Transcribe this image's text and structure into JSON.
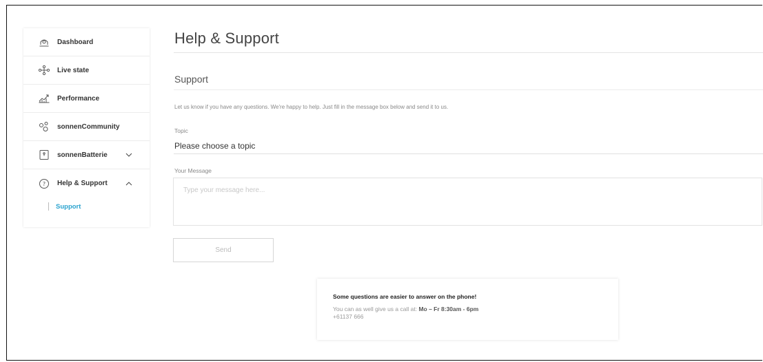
{
  "sidebar": {
    "items": [
      {
        "label": "Dashboard",
        "icon": "dashboard-icon"
      },
      {
        "label": "Live state",
        "icon": "live-state-icon"
      },
      {
        "label": "Performance",
        "icon": "performance-chart-icon"
      },
      {
        "label": "sonnenCommunity",
        "icon": "community-icon"
      },
      {
        "label": "sonnenBatterie",
        "icon": "battery-icon"
      },
      {
        "label": "Help & Support",
        "icon": "help-icon"
      }
    ],
    "sub_items": [
      {
        "label": "Support"
      }
    ]
  },
  "main": {
    "page_title": "Help & Support",
    "section_title": "Support",
    "intro": "Let us know if you have any questions. We're happy to help. Just fill in the message box below and send it to us.",
    "topic": {
      "label": "Topic",
      "value": "Please choose a topic"
    },
    "message": {
      "label": "Your Message",
      "placeholder": "Type your message here..."
    },
    "send_label": "Send",
    "phone_card": {
      "header": "Some questions are easier to answer on the phone!",
      "line1_prefix": "You can as well give us a call at: ",
      "hours": "Mo – Fr 8:30am - 6pm",
      "phone": "+61137 666"
    }
  },
  "colors": {
    "accent": "#2aa3cf",
    "border": "#e2e2e2",
    "muted_text": "#888888"
  }
}
